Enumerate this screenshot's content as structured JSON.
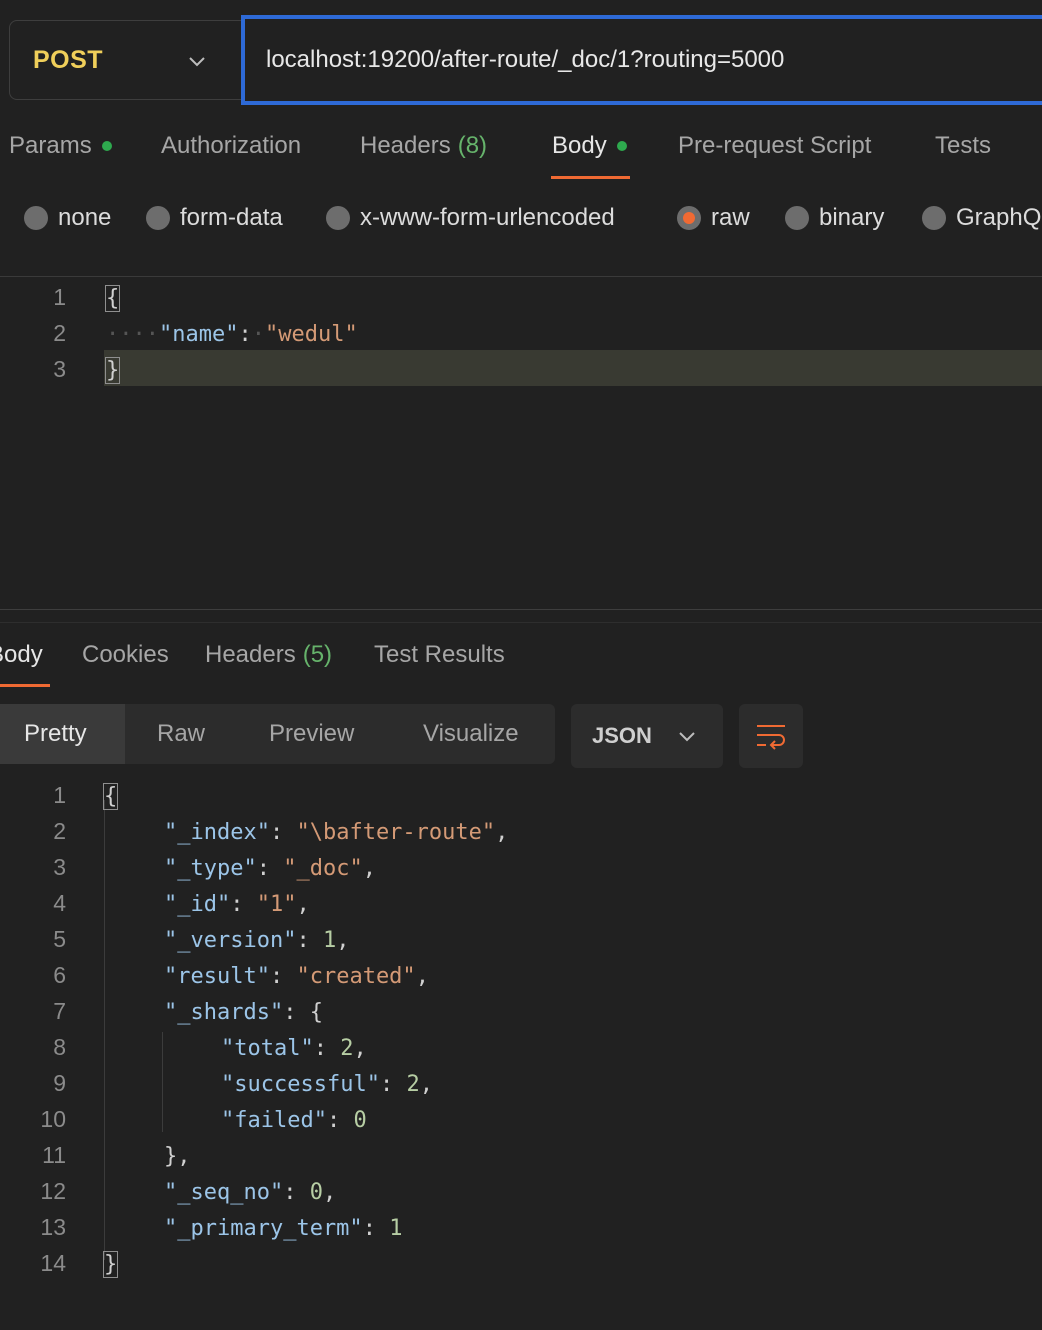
{
  "request": {
    "method": "POST",
    "url": "localhost:19200/after-route/_doc/1?routing=5000"
  },
  "request_tabs": [
    {
      "label": "Params",
      "dot": true
    },
    {
      "label": "Authorization"
    },
    {
      "label": "Headers",
      "count": "(8)"
    },
    {
      "label": "Body",
      "dot": true,
      "active": true
    },
    {
      "label": "Pre-request Script"
    },
    {
      "label": "Tests"
    }
  ],
  "body_types": [
    {
      "label": "none"
    },
    {
      "label": "form-data"
    },
    {
      "label": "x-www-form-urlencoded"
    },
    {
      "label": "raw",
      "selected": true
    },
    {
      "label": "binary"
    },
    {
      "label": "GraphQ"
    }
  ],
  "request_body": {
    "line_numbers": [
      "1",
      "2",
      "3"
    ],
    "open_brace": "{",
    "key": "\"name\"",
    "colon": ":",
    "value": "\"wedul\"",
    "close_brace": "}"
  },
  "response_tabs": [
    {
      "label": "Body",
      "active": true
    },
    {
      "label": "Cookies"
    },
    {
      "label": "Headers",
      "count": "(5)"
    },
    {
      "label": "Test Results"
    }
  ],
  "view_modes": [
    "Pretty",
    "Raw",
    "Preview",
    "Visualize"
  ],
  "format": "JSON",
  "response_body": {
    "line_numbers": [
      "1",
      "2",
      "3",
      "4",
      "5",
      "6",
      "7",
      "8",
      "9",
      "10",
      "11",
      "12",
      "13",
      "14"
    ],
    "open_brace": "{",
    "close_brace": "}",
    "fields": [
      {
        "key": "\"_index\"",
        "value": "\"\\bafter-route\"",
        "tail": ","
      },
      {
        "key": "\"_type\"",
        "value": "\"_doc\"",
        "tail": ","
      },
      {
        "key": "\"_id\"",
        "value": "\"1\"",
        "tail": ","
      },
      {
        "key": "\"_version\"",
        "value": "1",
        "tail": ","
      },
      {
        "key": "\"result\"",
        "value": "\"created\"",
        "tail": ","
      },
      {
        "key": "\"_shards\"",
        "value": "{",
        "tail": ""
      }
    ],
    "shards": [
      {
        "key": "\"total\"",
        "value": "2",
        "tail": ","
      },
      {
        "key": "\"successful\"",
        "value": "2",
        "tail": ","
      },
      {
        "key": "\"failed\"",
        "value": "0",
        "tail": ""
      }
    ],
    "shards_close": "},",
    "tail_fields": [
      {
        "key": "\"_seq_no\"",
        "value": "0",
        "tail": ","
      },
      {
        "key": "\"_primary_term\"",
        "value": "1",
        "tail": ""
      }
    ]
  },
  "colors": {
    "accent": "#f06a33",
    "focus": "#2e6ad6",
    "method": "#f0cf5a",
    "status_dot": "#2ea94e"
  }
}
